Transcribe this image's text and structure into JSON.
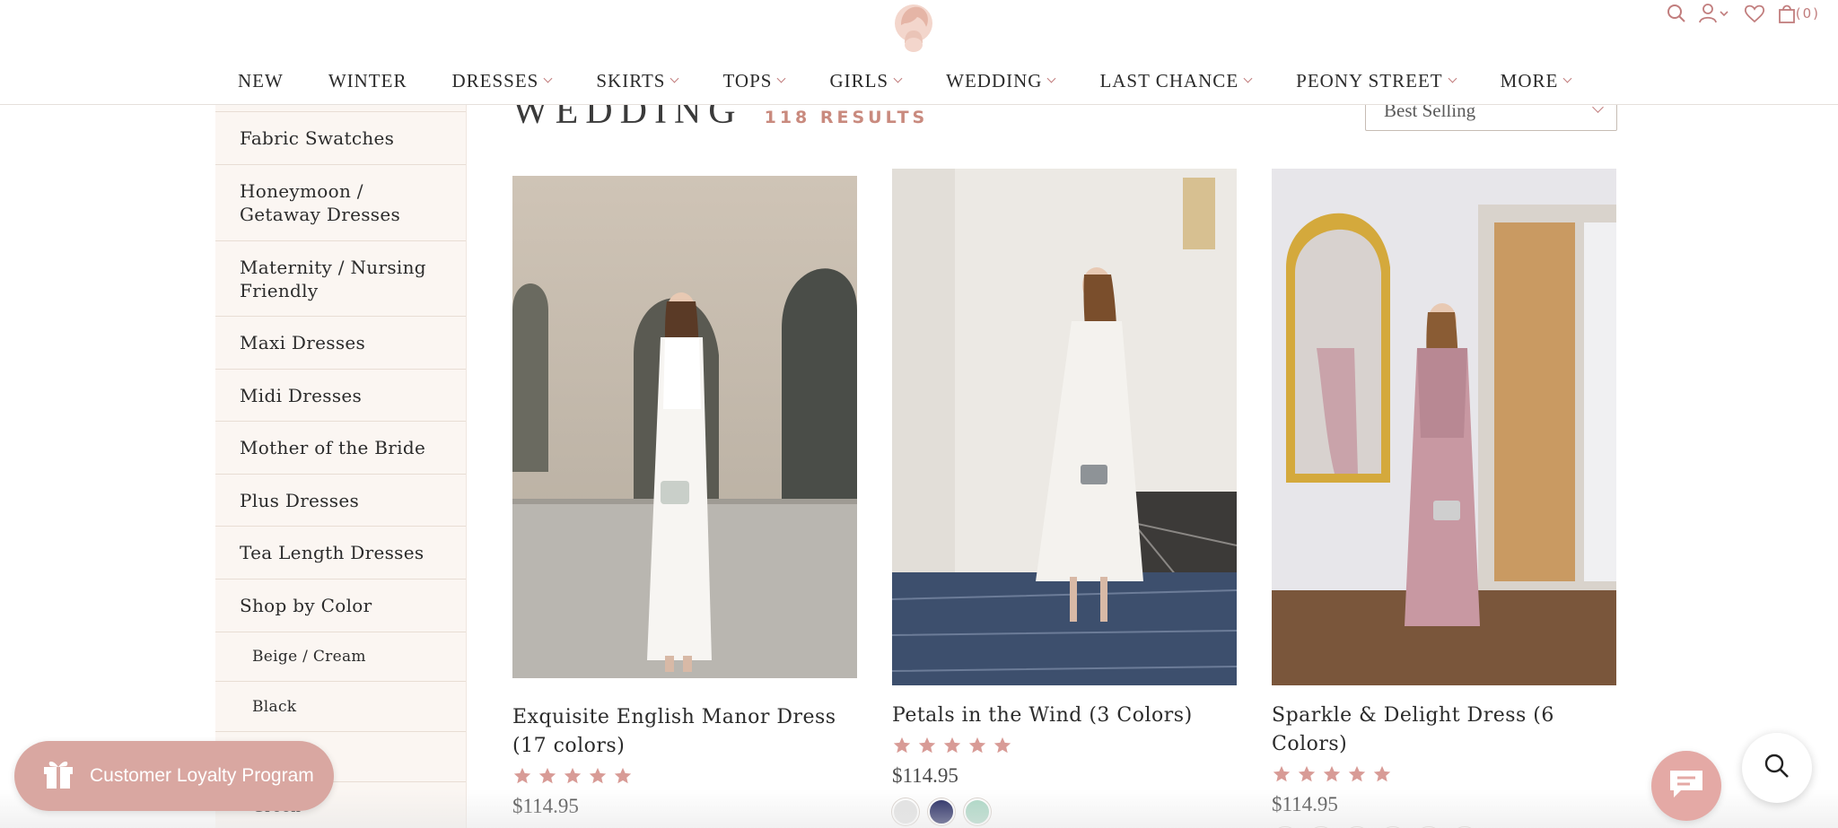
{
  "brand": {
    "logo_icon": "woman-silhouette-logo"
  },
  "header": {
    "icons": [
      "search-icon",
      "account-icon",
      "heart-icon",
      "cart-icon"
    ],
    "cart_count": "(0)",
    "accent": "#c17d7d"
  },
  "nav": {
    "items": [
      {
        "label": "NEW"
      },
      {
        "label": "WINTER"
      },
      {
        "label": "DRESSES"
      },
      {
        "label": "SKIRTS"
      },
      {
        "label": "TOPS"
      },
      {
        "label": "GIRLS"
      },
      {
        "label": "WEDDING"
      },
      {
        "label": "LAST CHANCE"
      },
      {
        "label": "PEONY STREET"
      },
      {
        "label": "MORE"
      }
    ]
  },
  "sidebar": {
    "items": [
      {
        "label": ""
      },
      {
        "label": "Fabric Swatches"
      },
      {
        "label": "Honeymoon / Getaway Dresses"
      },
      {
        "label": "Maternity / Nursing Friendly"
      },
      {
        "label": "Maxi Dresses"
      },
      {
        "label": "Midi Dresses"
      },
      {
        "label": "Mother of the Bride"
      },
      {
        "label": "Plus Dresses"
      },
      {
        "label": "Tea Length Dresses"
      },
      {
        "label": "Shop by Color"
      }
    ],
    "subitems": [
      {
        "label": "Beige / Cream"
      },
      {
        "label": "Black"
      },
      {
        "label": ""
      },
      {
        "label": "Green"
      }
    ]
  },
  "page": {
    "title": "WEDDING",
    "results": "118 RESULTS",
    "sort": {
      "selected": "Best Selling"
    }
  },
  "products": [
    {
      "name": "Exquisite English Manor Dress (17 colors)",
      "rating": 5,
      "price": "$114.95",
      "swatches": []
    },
    {
      "name": "Petals in the Wind (3 Colors)",
      "rating": 5,
      "price": "$114.95",
      "swatches": [
        "#e2e2e2",
        "#1a1f5a",
        "#a9d6c3"
      ]
    },
    {
      "name": "Sparkle & Delight Dress (6 Colors)",
      "rating": 5,
      "price": "$114.95",
      "swatches": [
        "#f5f5f5",
        "#e7bfcb",
        "#c8c8c8",
        "#9b1225",
        "#1b2466",
        "#0a0a0a"
      ]
    }
  ],
  "floating": {
    "loyalty_label": "Customer Loyalty Program",
    "loyalty_icon": "gift-icon",
    "chat_icon": "chat-bubble-icon",
    "search_icon": "search-icon"
  },
  "colors": {
    "star": "#d89b96",
    "loyalty_bg": "#d9a7a1",
    "results_accent": "#c98a7e"
  }
}
